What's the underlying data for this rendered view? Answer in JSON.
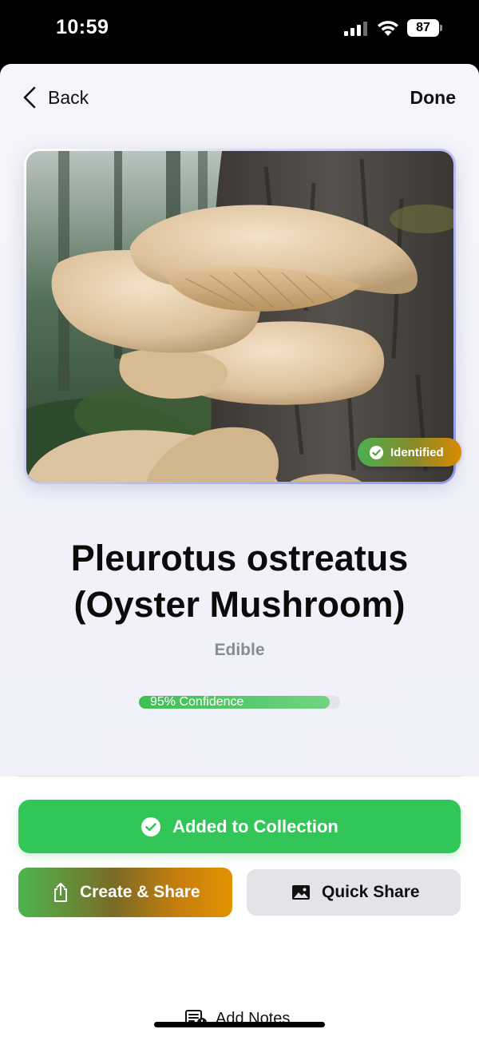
{
  "status_bar": {
    "time": "10:59",
    "battery": "87"
  },
  "nav": {
    "back_label": "Back",
    "done_label": "Done"
  },
  "photo": {
    "icon": "mushroom-photo",
    "badge_label": "Identified"
  },
  "result": {
    "species_name": "Pleurotus ostreatus (Oyster Mushroom)",
    "edibility": "Edible",
    "confidence_label": "95% Confidence",
    "confidence_value": 0.95
  },
  "actions": {
    "collection_label": "Added to Collection",
    "create_share_label": "Create & Share",
    "quick_share_label": "Quick Share",
    "add_notes_label": "Add Notes"
  },
  "colors": {
    "accent_green": "#32c659",
    "gradient_orange": "#e29200",
    "text_primary": "#0b0b0b",
    "text_secondary": "#8a8c93"
  }
}
